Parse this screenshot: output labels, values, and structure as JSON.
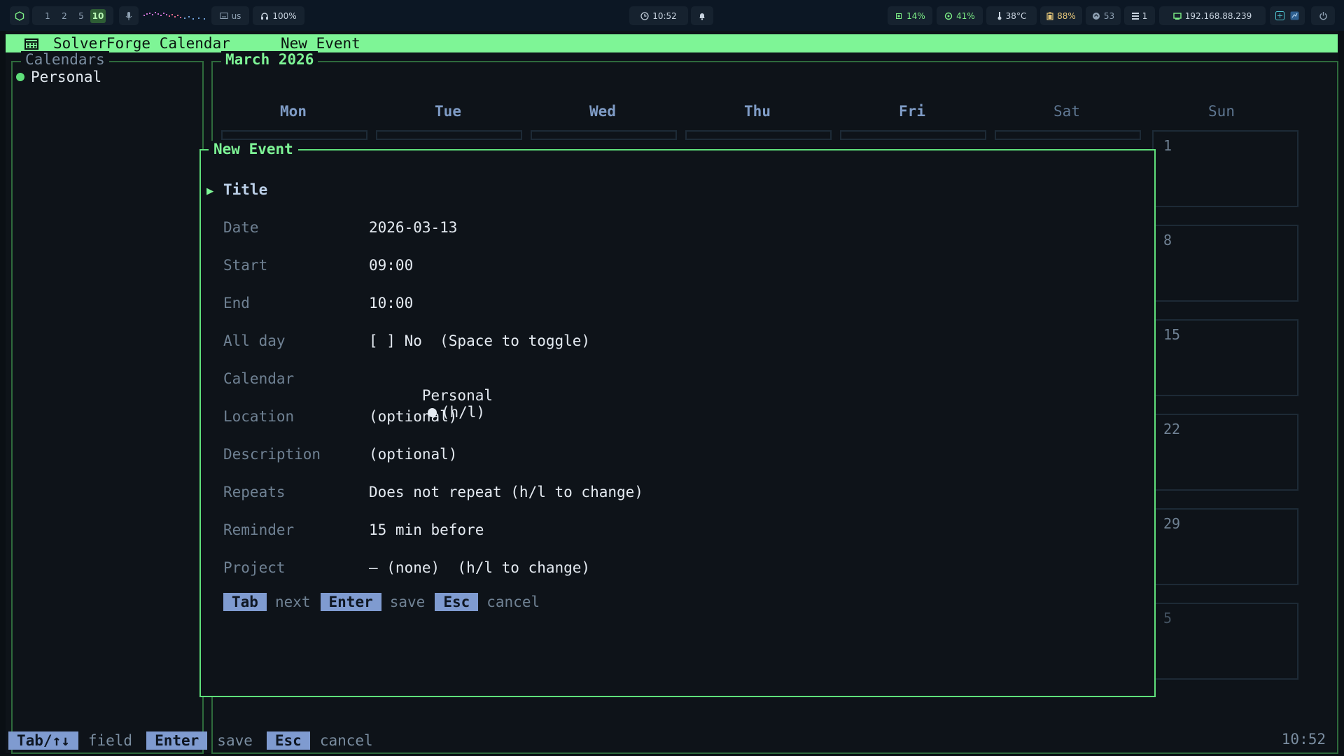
{
  "waybar": {
    "workspaces": [
      "1",
      "2",
      "5",
      "10"
    ],
    "active_workspace": "10",
    "keyboard": "us",
    "volume": "100%",
    "clock": "10:52",
    "cpu": "14%",
    "memory": "41%",
    "temperature": "38°C",
    "battery": "88%",
    "updates": "53",
    "windows": "1",
    "ip": "192.168.88.239"
  },
  "app": {
    "title": "SolverForge Calendar",
    "mode": "New Event"
  },
  "sidebar": {
    "title": "Calendars",
    "calendars": [
      {
        "name": "Personal",
        "color": "#5fe07b"
      }
    ]
  },
  "month": {
    "title": "March 2026",
    "weekdays": [
      "Mon",
      "Tue",
      "Wed",
      "Thu",
      "Fri",
      "Sat",
      "Sun"
    ],
    "sunday_days": [
      "1",
      "8",
      "15",
      "22",
      "29",
      "5"
    ]
  },
  "modal": {
    "title": "New Event",
    "title_field_label": "Title",
    "fields": [
      {
        "label": "Date",
        "value": "2026-03-13"
      },
      {
        "label": "Start",
        "value": "09:00"
      },
      {
        "label": "End",
        "value": "10:00"
      },
      {
        "label": "All day",
        "value": "[ ] No  (Space to toggle)"
      },
      {
        "label": "Calendar",
        "value": "Personal",
        "suffix": "(h/l)"
      },
      {
        "label": "Location",
        "value": "(optional)"
      },
      {
        "label": "Description",
        "value": "(optional)"
      },
      {
        "label": "Repeats",
        "value": "Does not repeat (h/l to change)"
      },
      {
        "label": "Reminder",
        "value": "15 min before"
      },
      {
        "label": "Project",
        "value": "— (none)  (h/l to change)"
      }
    ],
    "hints": [
      {
        "key": "Tab",
        "action": "next"
      },
      {
        "key": "Enter",
        "action": "save"
      },
      {
        "key": "Esc",
        "action": "cancel"
      }
    ]
  },
  "statusbar": {
    "hints": [
      {
        "key": "Tab/↑↓",
        "action": "field"
      },
      {
        "key": "Enter",
        "action": "save"
      },
      {
        "key": "Esc",
        "action": "cancel"
      }
    ],
    "clock": "10:52"
  },
  "colors": {
    "accent": "#7ef596",
    "key_bg": "#7f9bd0",
    "calendar_personal": "#5fe07b"
  }
}
